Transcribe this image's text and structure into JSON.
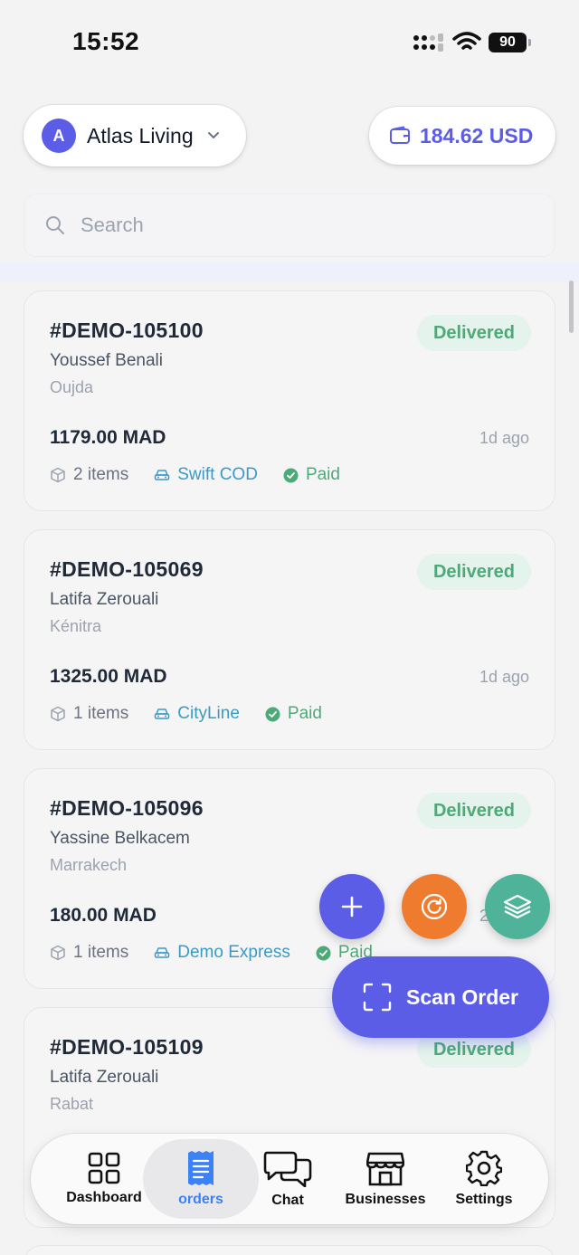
{
  "status_bar": {
    "time": "15:52",
    "battery": "90"
  },
  "header": {
    "business": {
      "initial": "A",
      "name": "Atlas Living"
    },
    "wallet": {
      "amount": "184.62 USD"
    }
  },
  "search": {
    "placeholder": "Search"
  },
  "orders": [
    {
      "id": "#DEMO-105100",
      "status": "Delivered",
      "customer": "Youssef Benali",
      "city": "Oujda",
      "amount": "1179.00 MAD",
      "time": "1d ago",
      "items": "2 items",
      "carrier": "Swift COD",
      "payment": "Paid"
    },
    {
      "id": "#DEMO-105069",
      "status": "Delivered",
      "customer": "Latifa Zerouali",
      "city": "Kénitra",
      "amount": "1325.00 MAD",
      "time": "1d ago",
      "items": "1 items",
      "carrier": "CityLine",
      "payment": "Paid"
    },
    {
      "id": "#DEMO-105096",
      "status": "Delivered",
      "customer": "Yassine Belkacem",
      "city": "Marrakech",
      "amount": "180.00 MAD",
      "time": "2d ago",
      "items": "1 items",
      "carrier": "Demo Express",
      "payment": "Paid"
    },
    {
      "id": "#DEMO-105109",
      "status": "Delivered",
      "customer": "Latifa Zerouali",
      "city": "Rabat"
    }
  ],
  "actions": {
    "scan_label": "Scan Order"
  },
  "nav": {
    "dashboard": "Dashboard",
    "orders": "orders",
    "chat": "Chat",
    "businesses": "Businesses",
    "settings": "Settings"
  },
  "colors": {
    "accent": "#5b5de6",
    "delivered": "#4ea978",
    "carrier": "#3b9ac4",
    "refresh_fab": "#ef7b2e",
    "layers_fab": "#4fb39a"
  }
}
